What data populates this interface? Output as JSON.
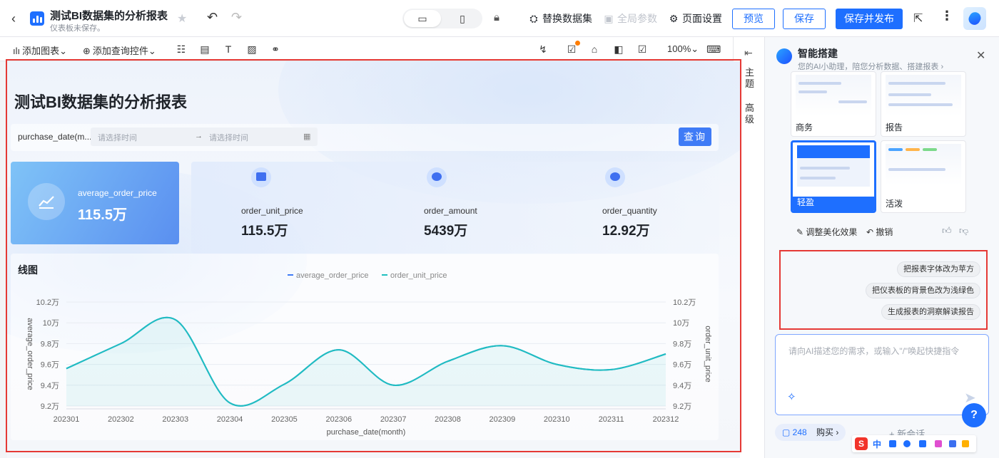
{
  "header": {
    "back_label": "‹",
    "title": "测试BI数据集的分析报表",
    "subtitle": "仪表板未保存。",
    "replace_dataset": "替换数据集",
    "global_params": "全局参数",
    "page_settings": "页面设置",
    "preview": "预览",
    "save": "保存",
    "save_publish": "保存并发布"
  },
  "toolbar": {
    "add_chart": "添加图表",
    "add_query": "添加查询控件",
    "zoom": "100%"
  },
  "rail": {
    "theme": "主题",
    "advanced": "高级"
  },
  "report": {
    "title": "测试BI数据集的分析报表",
    "filter_label": "purchase_date(m...",
    "start_placeholder": "请选择时间",
    "end_placeholder": "请选择时间",
    "arrow": "→",
    "query_button": "查询"
  },
  "kpis": [
    {
      "label": "average_order_price",
      "value": "115.5万"
    },
    {
      "label": "order_unit_price",
      "value": "115.5万"
    },
    {
      "label": "order_amount",
      "value": "5439万"
    },
    {
      "label": "order_quantity",
      "value": "12.92万"
    }
  ],
  "chart_data": {
    "type": "line",
    "title": "线图",
    "xlabel": "purchase_date(month)",
    "ylabel": "average_order_price",
    "y2label": "order_unit_price",
    "categories": [
      "202301",
      "202302",
      "202303",
      "202304",
      "202305",
      "202306",
      "202307",
      "202308",
      "202309",
      "202310",
      "202311",
      "202312"
    ],
    "series": [
      {
        "name": "average_order_price",
        "values": [
          9.56,
          9.8,
          10.03,
          9.23,
          9.41,
          9.74,
          9.4,
          9.63,
          9.78,
          9.6,
          9.55,
          9.7
        ],
        "color": "#3f7bf6"
      },
      {
        "name": "order_unit_price",
        "values": [
          9.56,
          9.8,
          10.03,
          9.23,
          9.41,
          9.74,
          9.4,
          9.63,
          9.78,
          9.6,
          9.55,
          9.7
        ],
        "color": "#1fbfbf"
      }
    ],
    "yticks": [
      "10.2万",
      "10万",
      "9.8万",
      "9.6万",
      "9.4万",
      "9.2万"
    ],
    "ylim": [
      9.2,
      10.2
    ],
    "legend_position": "top"
  },
  "panel": {
    "title": "智能搭建",
    "subtitle": "您的AI小助理，陪您分析数据、搭建报表 ›",
    "themes": [
      {
        "name": "商务"
      },
      {
        "name": "报告"
      },
      {
        "name": "轻盈"
      },
      {
        "name": "活泼"
      }
    ],
    "adjust": "调整美化效果",
    "undo": "撤销",
    "suggestions": [
      "把报表字体改为苹方",
      "把仪表板的背景色改为浅绿色",
      "生成报表的洞察解读报告"
    ],
    "input_placeholder": "请向AI描述您的需求，或输入\"/\"唤起快捷指令",
    "count": "248",
    "buy": "购买 ›",
    "new_chat": "+ 新会话",
    "help": "?"
  },
  "ime": {
    "logo": "S",
    "lang": "中"
  },
  "colors": {
    "accent": "#1e6fff",
    "line": "#1fbfbf",
    "frame": "#e53935"
  }
}
